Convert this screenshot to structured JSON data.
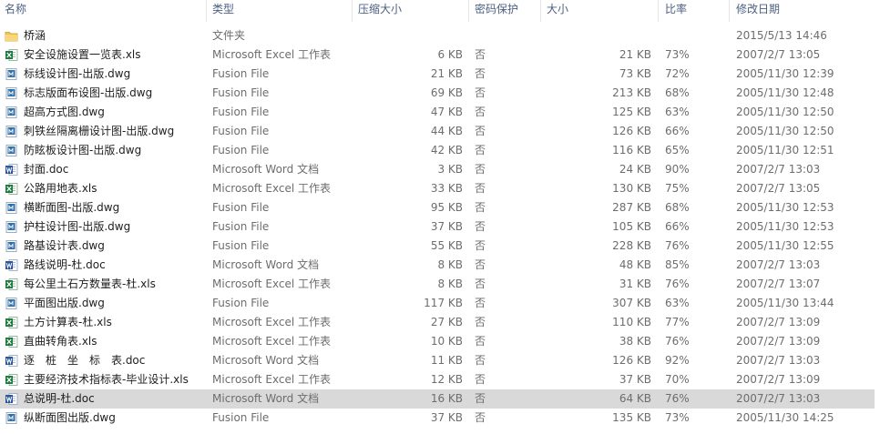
{
  "columns": {
    "name": "名称",
    "type": "类型",
    "compressed_size": "压缩大小",
    "password": "密码保护",
    "size": "大小",
    "ratio": "比率",
    "modified": "修改日期"
  },
  "rows": [
    {
      "name": "桥涵",
      "type": "文件夹",
      "csize": "",
      "pwd": "",
      "size": "",
      "ratio": "",
      "date": "2015/5/13 14:46",
      "icon": "folder-icon",
      "selected": false
    },
    {
      "name": "安全设施设置一览表.xls",
      "type": "Microsoft Excel 工作表",
      "csize": "6 KB",
      "pwd": "否",
      "size": "21 KB",
      "ratio": "73%",
      "date": "2007/2/7 13:05",
      "icon": "excel-icon",
      "selected": false
    },
    {
      "name": "标线设计图-出版.dwg",
      "type": "Fusion File",
      "csize": "21 KB",
      "pwd": "否",
      "size": "73 KB",
      "ratio": "72%",
      "date": "2005/11/30 12:39",
      "icon": "dwg-icon",
      "selected": false
    },
    {
      "name": "标志版面布设图-出版.dwg",
      "type": "Fusion File",
      "csize": "69 KB",
      "pwd": "否",
      "size": "213 KB",
      "ratio": "68%",
      "date": "2005/11/30 12:48",
      "icon": "dwg-icon",
      "selected": false
    },
    {
      "name": "超高方式图.dwg",
      "type": "Fusion File",
      "csize": "47 KB",
      "pwd": "否",
      "size": "125 KB",
      "ratio": "63%",
      "date": "2005/11/30 12:50",
      "icon": "dwg-icon",
      "selected": false
    },
    {
      "name": "刺铁丝隔离栅设计图-出版.dwg",
      "type": "Fusion File",
      "csize": "44 KB",
      "pwd": "否",
      "size": "126 KB",
      "ratio": "66%",
      "date": "2005/11/30 12:50",
      "icon": "dwg-icon",
      "selected": false
    },
    {
      "name": "防眩板设计图-出版.dwg",
      "type": "Fusion File",
      "csize": "42 KB",
      "pwd": "否",
      "size": "116 KB",
      "ratio": "65%",
      "date": "2005/11/30 12:51",
      "icon": "dwg-icon",
      "selected": false
    },
    {
      "name": "封面.doc",
      "type": "Microsoft Word 文档",
      "csize": "3 KB",
      "pwd": "否",
      "size": "24 KB",
      "ratio": "90%",
      "date": "2007/2/7 13:03",
      "icon": "word-icon",
      "selected": false
    },
    {
      "name": "公路用地表.xls",
      "type": "Microsoft Excel 工作表",
      "csize": "33 KB",
      "pwd": "否",
      "size": "130 KB",
      "ratio": "75%",
      "date": "2007/2/7 13:05",
      "icon": "excel-icon",
      "selected": false
    },
    {
      "name": "横断面图-出版.dwg",
      "type": "Fusion File",
      "csize": "95 KB",
      "pwd": "否",
      "size": "287 KB",
      "ratio": "68%",
      "date": "2005/11/30 12:53",
      "icon": "dwg-icon",
      "selected": false
    },
    {
      "name": "护柱设计图-出版.dwg",
      "type": "Fusion File",
      "csize": "37 KB",
      "pwd": "否",
      "size": "105 KB",
      "ratio": "66%",
      "date": "2005/11/30 12:53",
      "icon": "dwg-icon",
      "selected": false
    },
    {
      "name": "路基设计表.dwg",
      "type": "Fusion File",
      "csize": "55 KB",
      "pwd": "否",
      "size": "228 KB",
      "ratio": "76%",
      "date": "2005/11/30 12:55",
      "icon": "dwg-icon",
      "selected": false
    },
    {
      "name": "路线说明-杜.doc",
      "type": "Microsoft Word 文档",
      "csize": "8 KB",
      "pwd": "否",
      "size": "48 KB",
      "ratio": "85%",
      "date": "2007/2/7 13:03",
      "icon": "word-icon",
      "selected": false
    },
    {
      "name": "每公里土石方数量表-杜.xls",
      "type": "Microsoft Excel 工作表",
      "csize": "8 KB",
      "pwd": "否",
      "size": "31 KB",
      "ratio": "76%",
      "date": "2007/2/7 13:07",
      "icon": "excel-icon",
      "selected": false
    },
    {
      "name": "平面图出版.dwg",
      "type": "Fusion File",
      "csize": "117 KB",
      "pwd": "否",
      "size": "307 KB",
      "ratio": "63%",
      "date": "2005/11/30 13:44",
      "icon": "dwg-icon",
      "selected": false
    },
    {
      "name": "土方计算表-杜.xls",
      "type": "Microsoft Excel 工作表",
      "csize": "27 KB",
      "pwd": "否",
      "size": "110 KB",
      "ratio": "77%",
      "date": "2007/2/7 13:09",
      "icon": "excel-icon",
      "selected": false
    },
    {
      "name": "直曲转角表.xls",
      "type": "Microsoft Excel 工作表",
      "csize": "10 KB",
      "pwd": "否",
      "size": "38 KB",
      "ratio": "76%",
      "date": "2007/2/7 13:09",
      "icon": "excel-icon",
      "selected": false
    },
    {
      "name": "逐　桩　坐　标　表.doc",
      "type": "Microsoft Word 文档",
      "csize": "11 KB",
      "pwd": "否",
      "size": "126 KB",
      "ratio": "92%",
      "date": "2007/2/7 13:03",
      "icon": "word-icon",
      "selected": false
    },
    {
      "name": "主要经济技术指标表-毕业设计.xls",
      "type": "Microsoft Excel 工作表",
      "csize": "12 KB",
      "pwd": "否",
      "size": "37 KB",
      "ratio": "70%",
      "date": "2007/2/7 13:09",
      "icon": "excel-icon",
      "selected": false
    },
    {
      "name": "总说明-杜.doc",
      "type": "Microsoft Word 文档",
      "csize": "16 KB",
      "pwd": "否",
      "size": "64 KB",
      "ratio": "76%",
      "date": "2007/2/7 13:03",
      "icon": "word-icon",
      "selected": true
    },
    {
      "name": "纵断面图出版.dwg",
      "type": "Fusion File",
      "csize": "37 KB",
      "pwd": "否",
      "size": "135 KB",
      "ratio": "73%",
      "date": "2005/11/30 14:25",
      "icon": "dwg-icon",
      "selected": false
    }
  ],
  "colors": {
    "header_text": "#4d6082",
    "row_selected": "#d9d9d9",
    "secondary_text": "#6d6d6d",
    "folder": "#f0c552",
    "excel": "#1f7a3e",
    "word": "#2b579a",
    "dwg": "#2f6fa8"
  }
}
